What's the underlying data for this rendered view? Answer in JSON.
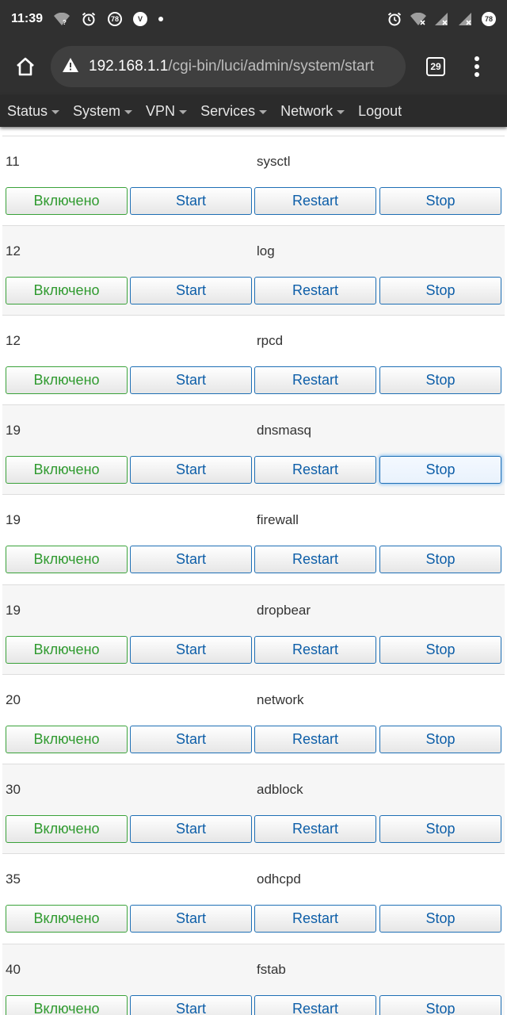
{
  "statusbar": {
    "time": "11:39",
    "badge_left": "78",
    "badge_right": "78"
  },
  "browser": {
    "url_host": "192.168.1.1",
    "url_path": "/cgi-bin/luci/admin/system/start",
    "tab_count": "29"
  },
  "nav": {
    "items": [
      {
        "label": "Status",
        "dropdown": true
      },
      {
        "label": "System",
        "dropdown": true
      },
      {
        "label": "VPN",
        "dropdown": true
      },
      {
        "label": "Services",
        "dropdown": true
      },
      {
        "label": "Network",
        "dropdown": true
      },
      {
        "label": "Logout",
        "dropdown": false
      }
    ]
  },
  "labels": {
    "enabled": "Включено",
    "start": "Start",
    "restart": "Restart",
    "stop": "Stop"
  },
  "rows": [
    {
      "priority": "11",
      "name": "sysctl"
    },
    {
      "priority": "12",
      "name": "log"
    },
    {
      "priority": "12",
      "name": "rpcd"
    },
    {
      "priority": "19",
      "name": "dnsmasq",
      "focused_button": "stop"
    },
    {
      "priority": "19",
      "name": "firewall"
    },
    {
      "priority": "19",
      "name": "dropbear"
    },
    {
      "priority": "20",
      "name": "network"
    },
    {
      "priority": "30",
      "name": "adblock"
    },
    {
      "priority": "35",
      "name": "odhcpd"
    },
    {
      "priority": "40",
      "name": "fstab"
    }
  ]
}
